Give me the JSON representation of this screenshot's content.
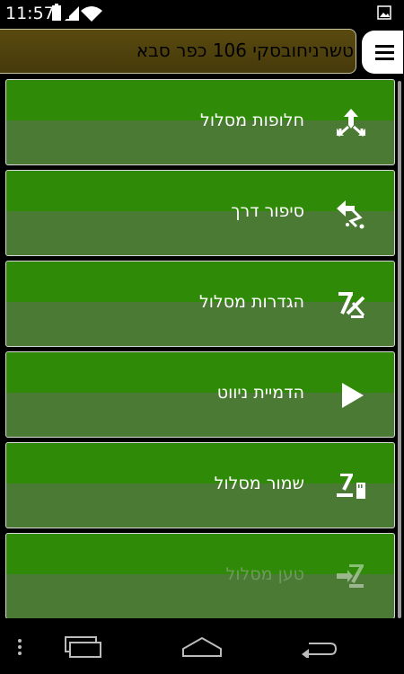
{
  "status_bar": {
    "time": "11:57",
    "icons": [
      "battery-icon",
      "signal-icon",
      "wifi-icon",
      "image-notification-icon"
    ]
  },
  "header": {
    "address": "טשרניחובסקי 106 כפר סבא",
    "menu_icon": "hamburger-menu-icon",
    "background": "#4f4210"
  },
  "menu": {
    "items": [
      {
        "label": "חלופות מסלול",
        "icon": "route-alternatives-icon",
        "enabled": true
      },
      {
        "label": "סיפור דרך",
        "icon": "turn-by-turn-icon",
        "enabled": true
      },
      {
        "label": "הגדרות מסלול",
        "icon": "route-settings-icon",
        "enabled": true
      },
      {
        "label": "הדמיית ניווט",
        "icon": "play-icon",
        "enabled": true
      },
      {
        "label": "שמור מסלול",
        "icon": "save-route-icon",
        "enabled": true
      },
      {
        "label": "טען מסלול",
        "icon": "load-route-icon",
        "enabled": false
      }
    ],
    "accent_top": "#2f8a07",
    "accent_bottom": "#4a7a34"
  },
  "nav_bar": {
    "icons": [
      "overflow-menu-icon",
      "recent-apps-icon",
      "home-icon",
      "back-icon"
    ]
  }
}
